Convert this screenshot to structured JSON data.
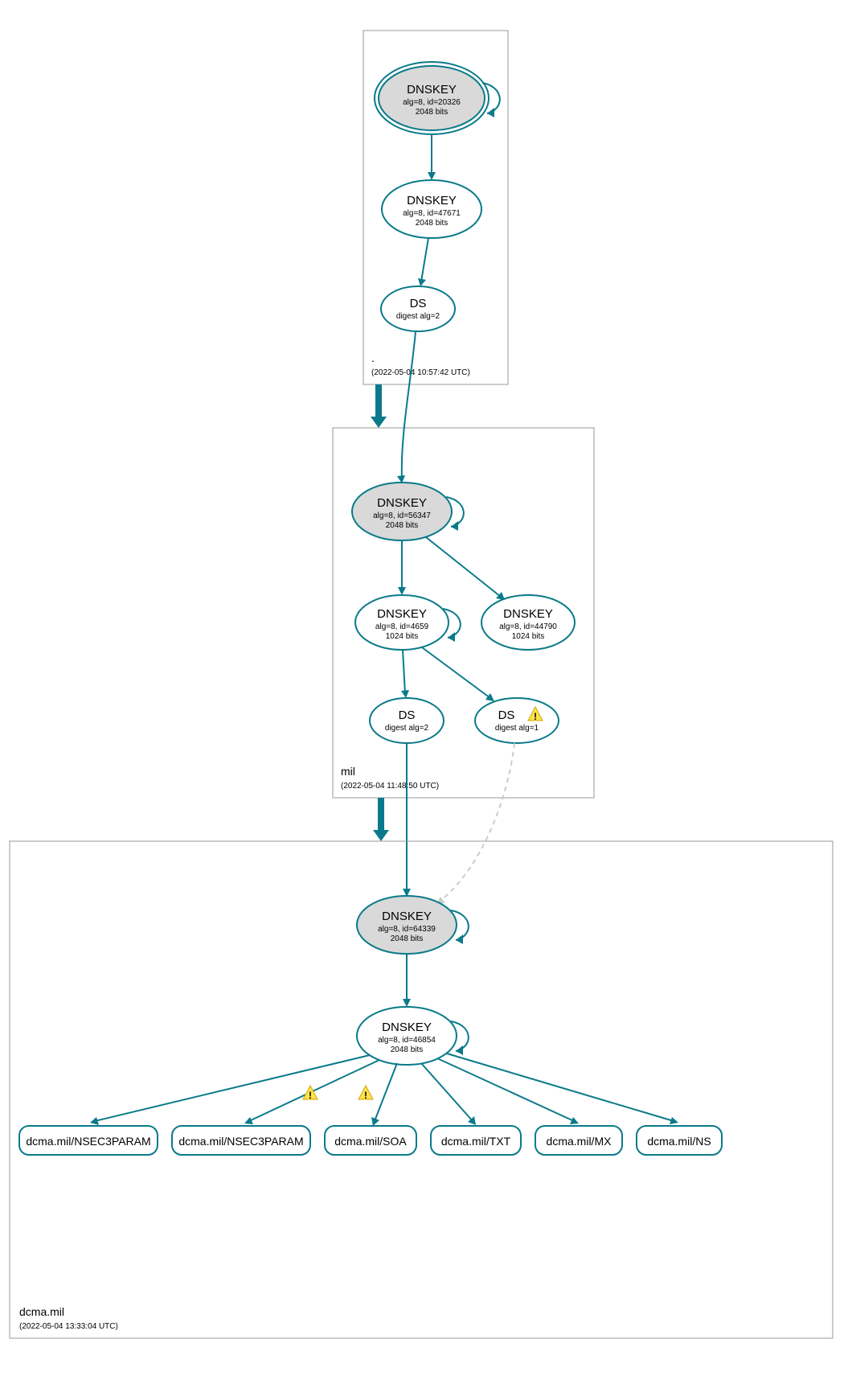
{
  "colors": {
    "line": "#0a7a8a",
    "ksk_fill": "#d9d9d9",
    "box": "#999999",
    "warn": "#ffe34d"
  },
  "zones": {
    "root": {
      "name": ".",
      "timestamp": "(2022-05-04 10:57:42 UTC)"
    },
    "mil": {
      "name": "mil",
      "timestamp": "(2022-05-04 11:48:50 UTC)"
    },
    "dcma": {
      "name": "dcma.mil",
      "timestamp": "(2022-05-04 13:33:04 UTC)"
    }
  },
  "nodes": {
    "root_ksk": {
      "title": "DNSKEY",
      "sub1": "alg=8, id=20326",
      "sub2": "2048 bits"
    },
    "root_zsk": {
      "title": "DNSKEY",
      "sub1": "alg=8, id=47671",
      "sub2": "2048 bits"
    },
    "root_ds": {
      "title": "DS",
      "sub1": "digest alg=2"
    },
    "mil_ksk": {
      "title": "DNSKEY",
      "sub1": "alg=8, id=56347",
      "sub2": "2048 bits"
    },
    "mil_zsk1": {
      "title": "DNSKEY",
      "sub1": "alg=8, id=4659",
      "sub2": "1024 bits"
    },
    "mil_zsk2": {
      "title": "DNSKEY",
      "sub1": "alg=8, id=44790",
      "sub2": "1024 bits"
    },
    "mil_ds1": {
      "title": "DS",
      "sub1": "digest alg=2"
    },
    "mil_ds2": {
      "title": "DS",
      "sub1": "digest alg=1"
    },
    "dcma_ksk": {
      "title": "DNSKEY",
      "sub1": "alg=8, id=64339",
      "sub2": "2048 bits"
    },
    "dcma_zsk": {
      "title": "DNSKEY",
      "sub1": "alg=8, id=46854",
      "sub2": "2048 bits"
    }
  },
  "records": {
    "r1": "dcma.mil/NSEC3PARAM",
    "r2": "dcma.mil/NSEC3PARAM",
    "r3": "dcma.mil/SOA",
    "r4": "dcma.mil/TXT",
    "r5": "dcma.mil/MX",
    "r6": "dcma.mil/NS"
  },
  "edges": [
    {
      "from": "root_ksk",
      "to": "root_ksk",
      "self": true
    },
    {
      "from": "root_ksk",
      "to": "root_zsk"
    },
    {
      "from": "root_zsk",
      "to": "root_ds"
    },
    {
      "from": "root_ds",
      "to": "mil_ksk"
    },
    {
      "from": "mil_ksk",
      "to": "mil_ksk",
      "self": true
    },
    {
      "from": "mil_ksk",
      "to": "mil_zsk1"
    },
    {
      "from": "mil_ksk",
      "to": "mil_zsk2"
    },
    {
      "from": "mil_zsk1",
      "to": "mil_zsk1",
      "self": true
    },
    {
      "from": "mil_zsk1",
      "to": "mil_ds1"
    },
    {
      "from": "mil_zsk1",
      "to": "mil_ds2",
      "warn": true
    },
    {
      "from": "mil_ds1",
      "to": "dcma_ksk"
    },
    {
      "from": "mil_ds2",
      "to": "dcma_ksk",
      "dashed": true
    },
    {
      "from": "dcma_ksk",
      "to": "dcma_ksk",
      "self": true
    },
    {
      "from": "dcma_ksk",
      "to": "dcma_zsk"
    },
    {
      "from": "dcma_zsk",
      "to": "dcma_zsk",
      "self": true
    },
    {
      "from": "dcma_zsk",
      "to": "r1"
    },
    {
      "from": "dcma_zsk",
      "to": "r2",
      "warn": true
    },
    {
      "from": "dcma_zsk",
      "to": "r3",
      "warn": true
    },
    {
      "from": "dcma_zsk",
      "to": "r4"
    },
    {
      "from": "dcma_zsk",
      "to": "r5"
    },
    {
      "from": "dcma_zsk",
      "to": "r6"
    }
  ],
  "zone_delegations": [
    {
      "from": "root",
      "to": "mil"
    },
    {
      "from": "mil",
      "to": "dcma"
    }
  ]
}
